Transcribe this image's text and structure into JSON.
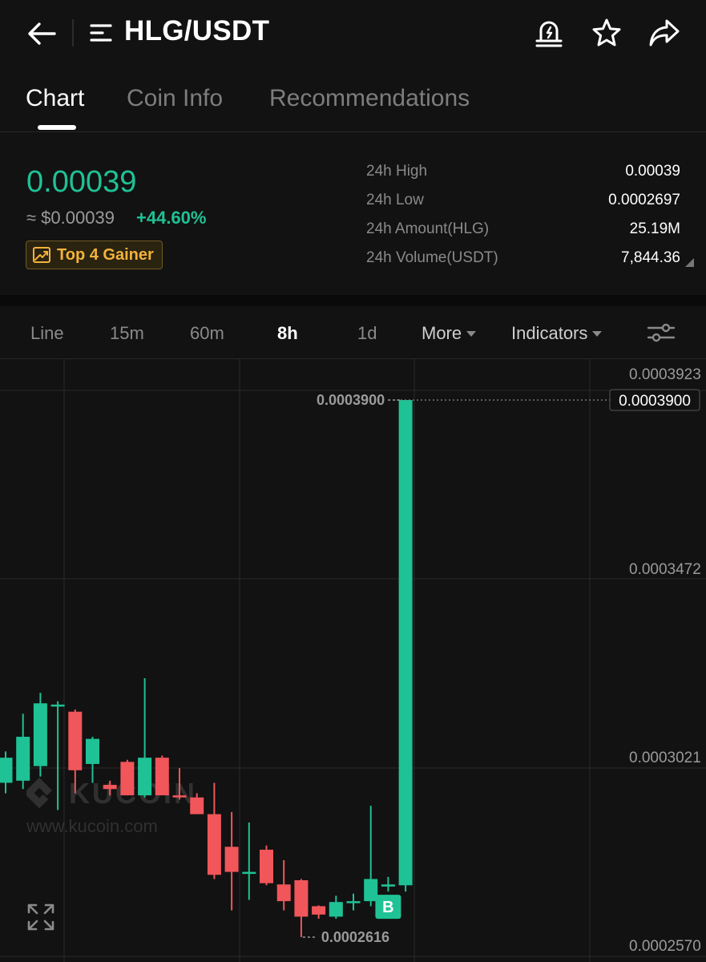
{
  "header": {
    "pair": "HLG/USDT",
    "icons": [
      "back-arrow-icon",
      "menu-icon",
      "alert-bell-icon",
      "star-icon",
      "share-icon"
    ]
  },
  "tabs": [
    {
      "label": "Chart",
      "active": true
    },
    {
      "label": "Coin Info",
      "active": false
    },
    {
      "label": "Recommendations",
      "active": false
    }
  ],
  "ticker": {
    "price": "0.00039",
    "price_usd": "≈ $0.00039",
    "change": "+44.60%",
    "badge": "Top 4 Gainer"
  },
  "stats": [
    {
      "label": "24h High",
      "value": "0.00039"
    },
    {
      "label": "24h Low",
      "value": "0.0002697"
    },
    {
      "label": "24h Amount(HLG)",
      "value": "25.19M"
    },
    {
      "label": "24h Volume(USDT)",
      "value": "7,844.36"
    }
  ],
  "chart_tabs": {
    "line": "Line",
    "m15": "15m",
    "m60": "60m",
    "h8": "8h",
    "d1": "1d",
    "more": "More",
    "indicators": "Indicators"
  },
  "colors": {
    "up": "#1fc295",
    "down": "#f0565a",
    "background": "#121212"
  },
  "watermark": {
    "brand": "KUCOIN",
    "url": "www.kucoin.com"
  },
  "chart_data": {
    "type": "candlestick",
    "interval": "8h",
    "price_axis_labels": [
      "0.0003923",
      "0.0003472",
      "0.0003021",
      "0.0002570"
    ],
    "ylim": [
      0.000255,
      0.0004
    ],
    "current_price_label": "0.0003900",
    "high_marker": "0.0003900",
    "low_marker": "0.0002616",
    "buy_marker": "B",
    "candles": [
      {
        "o": 0.0002985,
        "c": 0.0003045,
        "h": 0.000306,
        "l": 0.000296
      },
      {
        "o": 0.000299,
        "c": 0.0003095,
        "h": 0.000315,
        "l": 0.000297
      },
      {
        "o": 0.0003025,
        "c": 0.0003175,
        "h": 0.00032,
        "l": 0.0003
      },
      {
        "o": 0.0003168,
        "c": 0.0003172,
        "h": 0.000318,
        "l": 0.000292
      },
      {
        "o": 0.0003155,
        "c": 0.0003015,
        "h": 0.000316,
        "l": 0.000296
      },
      {
        "o": 0.000303,
        "c": 0.000309,
        "h": 0.0003095,
        "l": 0.0002985
      },
      {
        "o": 0.000298,
        "c": 0.000297,
        "h": 0.000299,
        "l": 0.0002955
      },
      {
        "o": 0.0003035,
        "c": 0.0002955,
        "h": 0.000304,
        "l": 0.0002955
      },
      {
        "o": 0.0002955,
        "c": 0.0003045,
        "h": 0.0003235,
        "l": 0.000295
      },
      {
        "o": 0.0003045,
        "c": 0.0002955,
        "h": 0.000305,
        "l": 0.0002955
      },
      {
        "o": 0.0002955,
        "c": 0.000295,
        "h": 0.000302,
        "l": 0.0002945
      },
      {
        "o": 0.000295,
        "c": 0.000291,
        "h": 0.000296,
        "l": 0.000291
      },
      {
        "o": 0.000291,
        "c": 0.0002765,
        "h": 0.0002985,
        "l": 0.0002755
      },
      {
        "o": 0.0002832,
        "c": 0.0002772,
        "h": 0.0002915,
        "l": 0.000268
      },
      {
        "o": 0.0002772,
        "c": 0.0002772,
        "h": 0.000289,
        "l": 0.0002705
      },
      {
        "o": 0.0002825,
        "c": 0.0002745,
        "h": 0.0002835,
        "l": 0.000274
      },
      {
        "o": 0.0002742,
        "c": 0.0002702,
        "h": 0.00028,
        "l": 0.000268
      },
      {
        "o": 0.0002752,
        "c": 0.0002665,
        "h": 0.0002755,
        "l": 0.0002616
      },
      {
        "o": 0.000269,
        "c": 0.000267,
        "h": 0.0002692,
        "l": 0.000266
      },
      {
        "o": 0.0002665,
        "c": 0.00027,
        "h": 0.0002715,
        "l": 0.000266
      },
      {
        "o": 0.00027,
        "c": 0.0002702,
        "h": 0.000272,
        "l": 0.000268
      },
      {
        "o": 0.0002702,
        "c": 0.0002755,
        "h": 0.000293,
        "l": 0.000269
      },
      {
        "o": 0.0002737,
        "c": 0.0002742,
        "h": 0.000276,
        "l": 0.0002725
      },
      {
        "o": 0.000274,
        "c": 0.00039,
        "h": 0.00039,
        "l": 0.0002725
      }
    ]
  }
}
